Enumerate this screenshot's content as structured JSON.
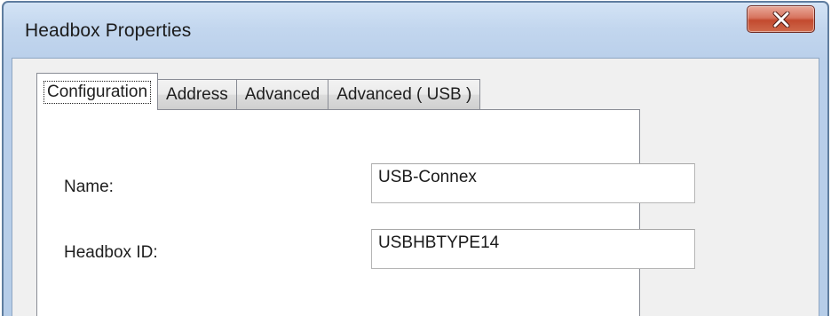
{
  "window": {
    "title": "Headbox Properties",
    "close_label": "X"
  },
  "tabs": [
    {
      "label": "Configuration",
      "active": true
    },
    {
      "label": "Address",
      "active": false
    },
    {
      "label": "Advanced",
      "active": false
    },
    {
      "label": "Advanced ( USB )",
      "active": false
    }
  ],
  "configuration": {
    "name_label": "Name:",
    "name_value": "USB-Connex",
    "headbox_id_label": "Headbox ID:",
    "headbox_id_value": "USBHBTYPE14"
  },
  "colors": {
    "title_bar": "#c2d6ee",
    "close_button": "#c34a2f",
    "client_background": "#f0f0f0",
    "panel_background": "#ffffff"
  }
}
